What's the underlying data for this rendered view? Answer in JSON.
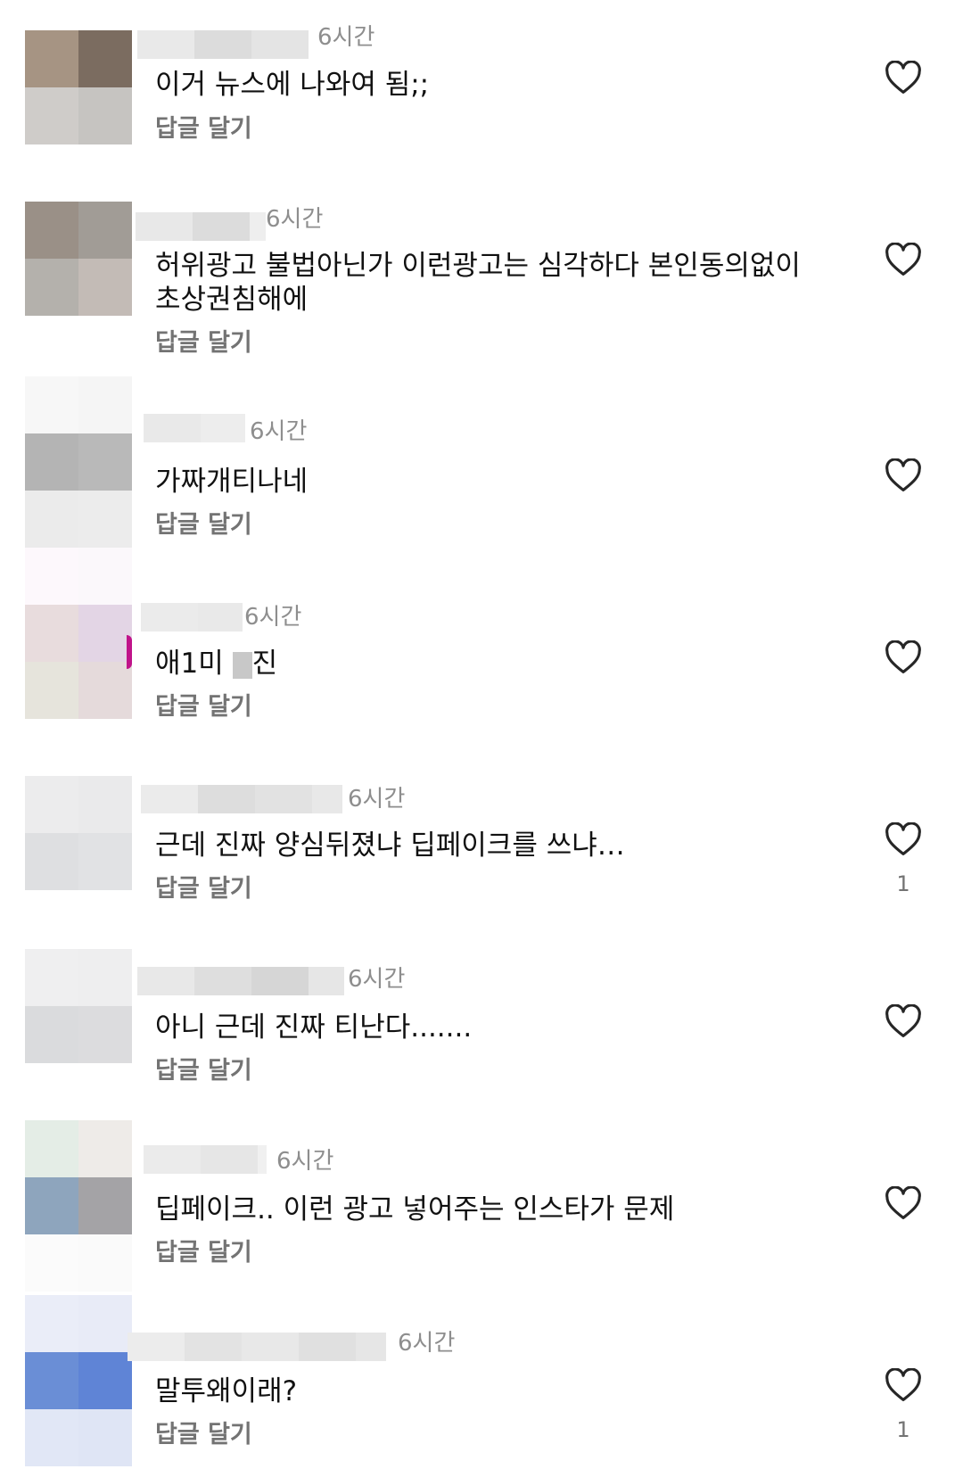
{
  "comments": [
    {
      "time": "6시간",
      "text": "이거 뉴스에 나와여 됨;;",
      "reply": "답글 달기",
      "likes": ""
    },
    {
      "time": "6시간",
      "text": "허위광고 불법아닌가 이런광고는 심각하다 본인동의없이 초상권침해에",
      "reply": "답글 달기",
      "likes": ""
    },
    {
      "time": "6시간",
      "text": "가짜개티나네",
      "reply": "답글 달기",
      "likes": ""
    },
    {
      "time": "6시간",
      "text_a": "애1미 ",
      "text_b": "진",
      "reply": "답글 달기",
      "likes": ""
    },
    {
      "time": "6시간",
      "text": "근데 진짜 양심뒤졌냐 딥페이크를 쓰냐…",
      "reply": "답글 달기",
      "likes": "1"
    },
    {
      "time": "6시간",
      "text": "아니 근데 진짜 티난다.......",
      "reply": "답글 달기",
      "likes": ""
    },
    {
      "time": "6시간",
      "text": "딥페이크.. 이런 광고 넣어주는 인스타가 문제",
      "reply": "답글 달기",
      "likes": ""
    },
    {
      "time": "6시간",
      "text": "말투왜이래?",
      "reply": "답글 달기",
      "likes": "1"
    }
  ],
  "icons": {
    "like": "heart-outline-icon"
  },
  "colors": {
    "time": "#8e8e8e",
    "reply": "#737373",
    "heart": "#262626"
  }
}
